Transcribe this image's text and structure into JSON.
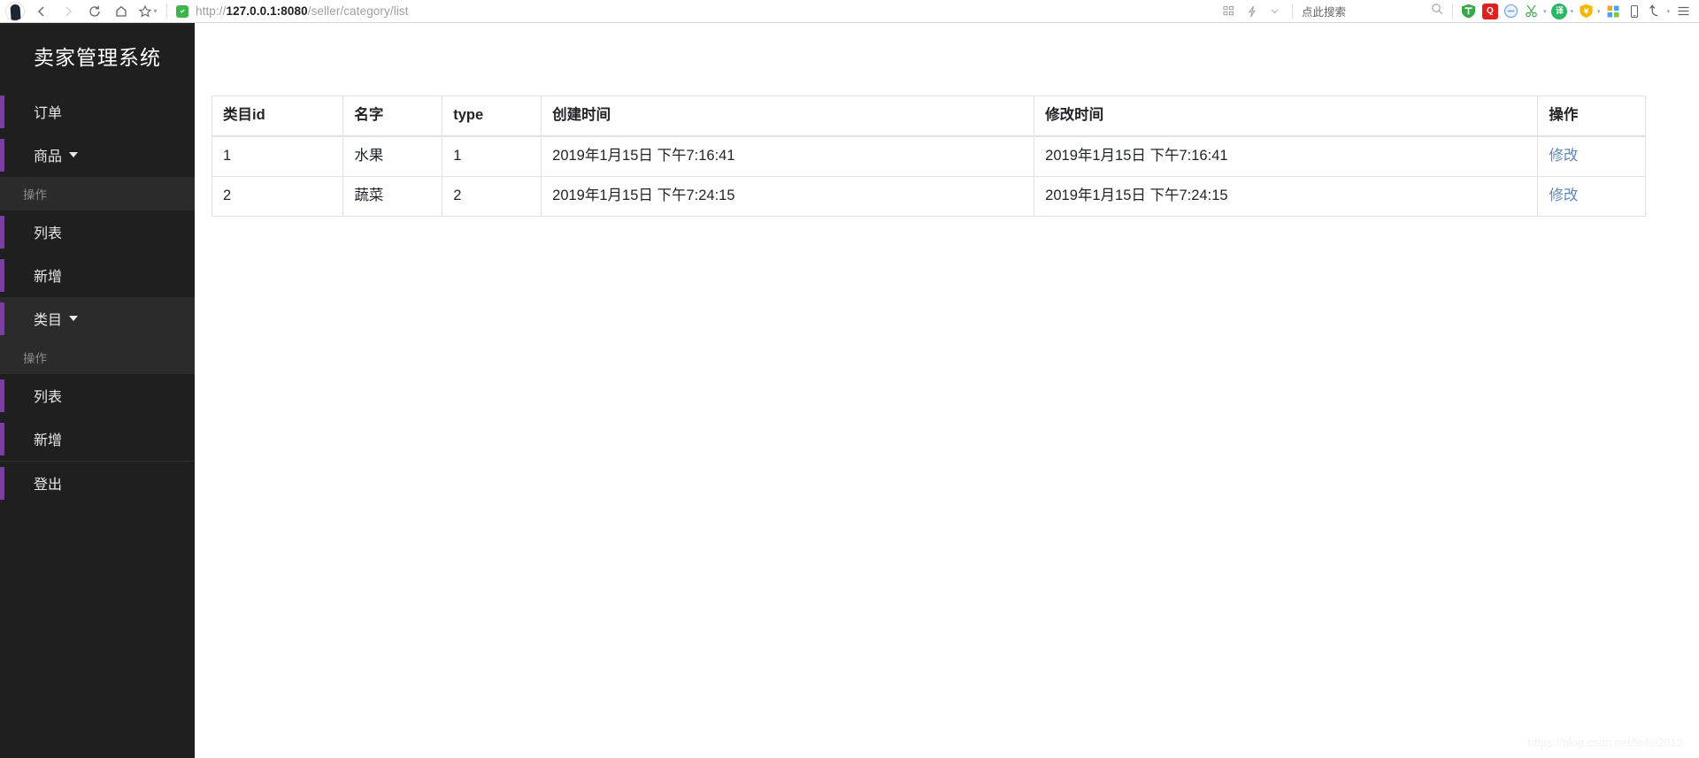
{
  "browser": {
    "nav": {
      "back_label": "Back",
      "forward_label": "Forward",
      "reload_label": "Reload",
      "home_label": "Home",
      "bookmark_label": "Bookmark"
    },
    "url": {
      "protocol": "http://",
      "host": "127.0.0.1:8080",
      "path": "/seller/category/list",
      "full": "http://127.0.0.1:8080/seller/category/list",
      "ssl_icon": "shield-check-icon"
    },
    "search": {
      "placeholder": "点此搜索",
      "icon": "search-icon"
    },
    "toolbar_icons": [
      {
        "name": "apps-grid-icon",
        "glyph": "∷"
      },
      {
        "name": "lightning-icon",
        "glyph": "⚡"
      },
      {
        "name": "chevron-down-icon",
        "glyph": "⌄"
      }
    ],
    "extensions": [
      {
        "name": "tampermonkey-icon",
        "label": "T",
        "color": "#3aa84a",
        "caret": false
      },
      {
        "name": "screenshot-icon",
        "label": "Q",
        "color": "#e02020",
        "caret": false
      },
      {
        "name": "adblock-icon",
        "label": "⊖",
        "color": "#7aa8e0",
        "caret": false
      },
      {
        "name": "scissors-icon",
        "label": "✂",
        "color": "#4caf50",
        "caret": true
      },
      {
        "name": "translate-icon",
        "label": "译",
        "color": "#29b765",
        "caret": true
      },
      {
        "name": "coupon-icon",
        "label": "¥",
        "color": "#f5b800",
        "caret": true
      },
      {
        "name": "windows-grid-icon",
        "label": "",
        "color": "#4aa3f0",
        "caret": false
      },
      {
        "name": "mobile-view-icon",
        "label": "",
        "color": "#5f6368",
        "caret": false
      },
      {
        "name": "history-undo-icon",
        "label": "↶",
        "color": "#5f6368",
        "caret": true
      },
      {
        "name": "browser-menu-icon",
        "label": "☰",
        "color": "#5f6368",
        "caret": false
      }
    ]
  },
  "sidebar": {
    "brand": "卖家管理系统",
    "accent_color": "#7b3fa0",
    "background": "#1f1f1f",
    "items": [
      {
        "label": "订单",
        "type": "link",
        "has_caret": false,
        "active": false
      },
      {
        "label": "商品",
        "type": "group",
        "has_caret": true,
        "active": false
      },
      {
        "label": "操作",
        "type": "section",
        "has_caret": false,
        "active": false
      },
      {
        "label": "列表",
        "type": "sub",
        "has_caret": false,
        "active": false
      },
      {
        "label": "新增",
        "type": "sub",
        "has_caret": false,
        "active": false
      },
      {
        "label": "类目",
        "type": "group",
        "has_caret": true,
        "active": true
      },
      {
        "label": "操作",
        "type": "section",
        "has_caret": false,
        "active": false
      },
      {
        "label": "列表",
        "type": "sub",
        "has_caret": false,
        "active": false
      },
      {
        "label": "新增",
        "type": "sub",
        "has_caret": false,
        "active": false
      },
      {
        "label": "登出",
        "type": "link",
        "has_caret": false,
        "active": false
      }
    ]
  },
  "main": {
    "table": {
      "columns": [
        {
          "key": "id",
          "label": "类目id"
        },
        {
          "key": "name",
          "label": "名字"
        },
        {
          "key": "type",
          "label": "type"
        },
        {
          "key": "created",
          "label": "创建时间"
        },
        {
          "key": "updated",
          "label": "修改时间"
        },
        {
          "key": "action",
          "label": "操作"
        }
      ],
      "rows": [
        {
          "id": "1",
          "name": "水果",
          "type": "1",
          "created": "2019年1月15日 下午7:16:41",
          "updated": "2019年1月15日 下午7:16:41",
          "action": "修改"
        },
        {
          "id": "2",
          "name": "蔬菜",
          "type": "2",
          "created": "2019年1月15日 下午7:24:15",
          "updated": "2019年1月15日 下午7:24:15",
          "action": "修改"
        }
      ],
      "link_color": "#5b88bf"
    },
    "watermark": "https://blog.csdn.net/leifei2012"
  }
}
